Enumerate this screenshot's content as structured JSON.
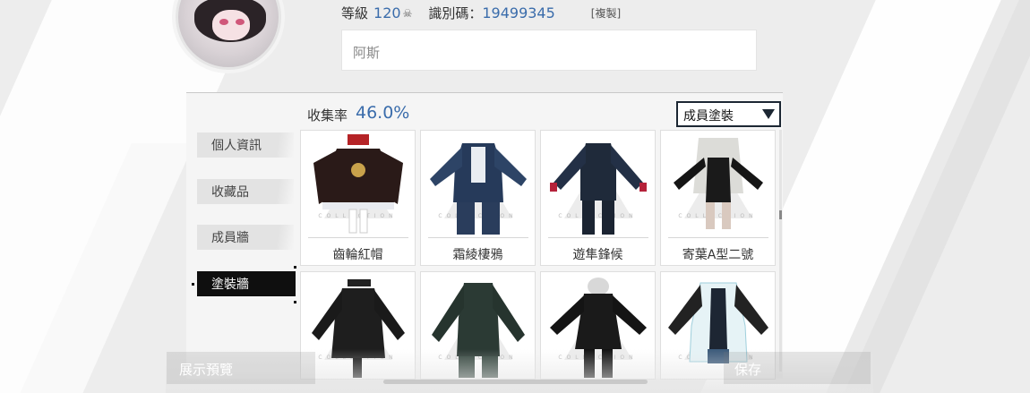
{
  "profile": {
    "level_label": "等級",
    "level_value": "120",
    "id_label": "識別碼：",
    "id_value": "19499345",
    "copy_label": "[複製]",
    "signature": "阿斯"
  },
  "panel": {
    "collection_label": "收集率",
    "collection_rate": "46.0%",
    "dropdown_selected": "成員塗裝"
  },
  "side_tabs": [
    {
      "label": "個人資訊",
      "active": false
    },
    {
      "label": "收藏品",
      "active": false
    },
    {
      "label": "成員牆",
      "active": false
    },
    {
      "label": "塗裝牆",
      "active": true
    }
  ],
  "cards": [
    {
      "name": "齒輪紅帽"
    },
    {
      "name": "霜綾棲鴉"
    },
    {
      "name": "遊隼鋒候"
    },
    {
      "name": "寄葉A型二號"
    },
    {
      "name": ""
    },
    {
      "name": ""
    },
    {
      "name": ""
    },
    {
      "name": ""
    }
  ],
  "card_watermark": "COLLECTION",
  "buttons": {
    "preview_label": "展示預覽",
    "save_label": "保存"
  },
  "colors": {
    "accent_blue": "#3a6cab",
    "active_tab_bg": "#0f0f0f",
    "dropdown_border": "#1c2733"
  }
}
